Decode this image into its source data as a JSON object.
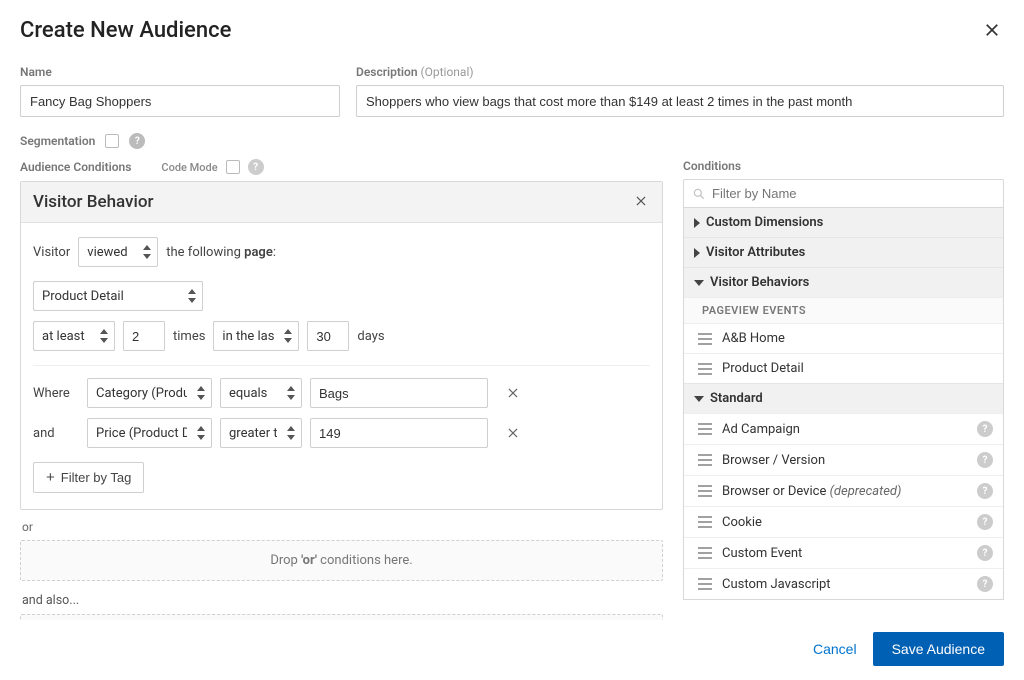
{
  "modal": {
    "title": "Create New Audience"
  },
  "form": {
    "name_label": "Name",
    "name_value": "Fancy Bag Shoppers",
    "desc_label": "Description",
    "desc_optional": "(Optional)",
    "desc_value": "Shoppers who view bags that cost more than $149 at least 2 times in the past month"
  },
  "segmentation": {
    "label": "Segmentation"
  },
  "audience_conditions_label": "Audience Conditions",
  "code_mode_label": "Code Mode",
  "behavior_card": {
    "title": "Visitor Behavior",
    "line1_prefix": "Visitor",
    "line1_action": "viewed",
    "line1_mid": "the following",
    "line1_object": "page",
    "page_select": "Product Detail",
    "freq_op": "at least",
    "freq_num": "2",
    "freq_unit": "times",
    "recency_op": "in the last",
    "recency_num": "30",
    "recency_unit": "days",
    "where_label": "Where",
    "and_label": "and",
    "filters": [
      {
        "attr": "Category (Product Detail)",
        "op": "equals",
        "value": "Bags"
      },
      {
        "attr": "Price (Product Detail)",
        "op": "greater than",
        "value": "149"
      }
    ],
    "filter_by_tag": "Filter by Tag"
  },
  "or_label": "or",
  "drop_or_text": "Drop 'or' conditions here.",
  "and_also_label": "and also...",
  "conditions_panel": {
    "title": "Conditions",
    "filter_placeholder": "Filter by Name",
    "groups": {
      "custom_dimensions": "Custom Dimensions",
      "visitor_attributes": "Visitor Attributes",
      "visitor_behaviors": "Visitor Behaviors",
      "pageview_header": "PAGEVIEW EVENTS",
      "pageview_items": [
        "A&B Home",
        "Product Detail"
      ],
      "standard": "Standard",
      "standard_items": [
        {
          "label": "Ad Campaign",
          "help": true
        },
        {
          "label": "Browser / Version",
          "help": true
        },
        {
          "label": "Browser or Device",
          "deprecated": "(deprecated)",
          "help": true
        },
        {
          "label": "Cookie",
          "help": true
        },
        {
          "label": "Custom Event",
          "help": true
        },
        {
          "label": "Custom Javascript",
          "help": true
        }
      ]
    }
  },
  "footer": {
    "cancel": "Cancel",
    "save": "Save Audience"
  }
}
